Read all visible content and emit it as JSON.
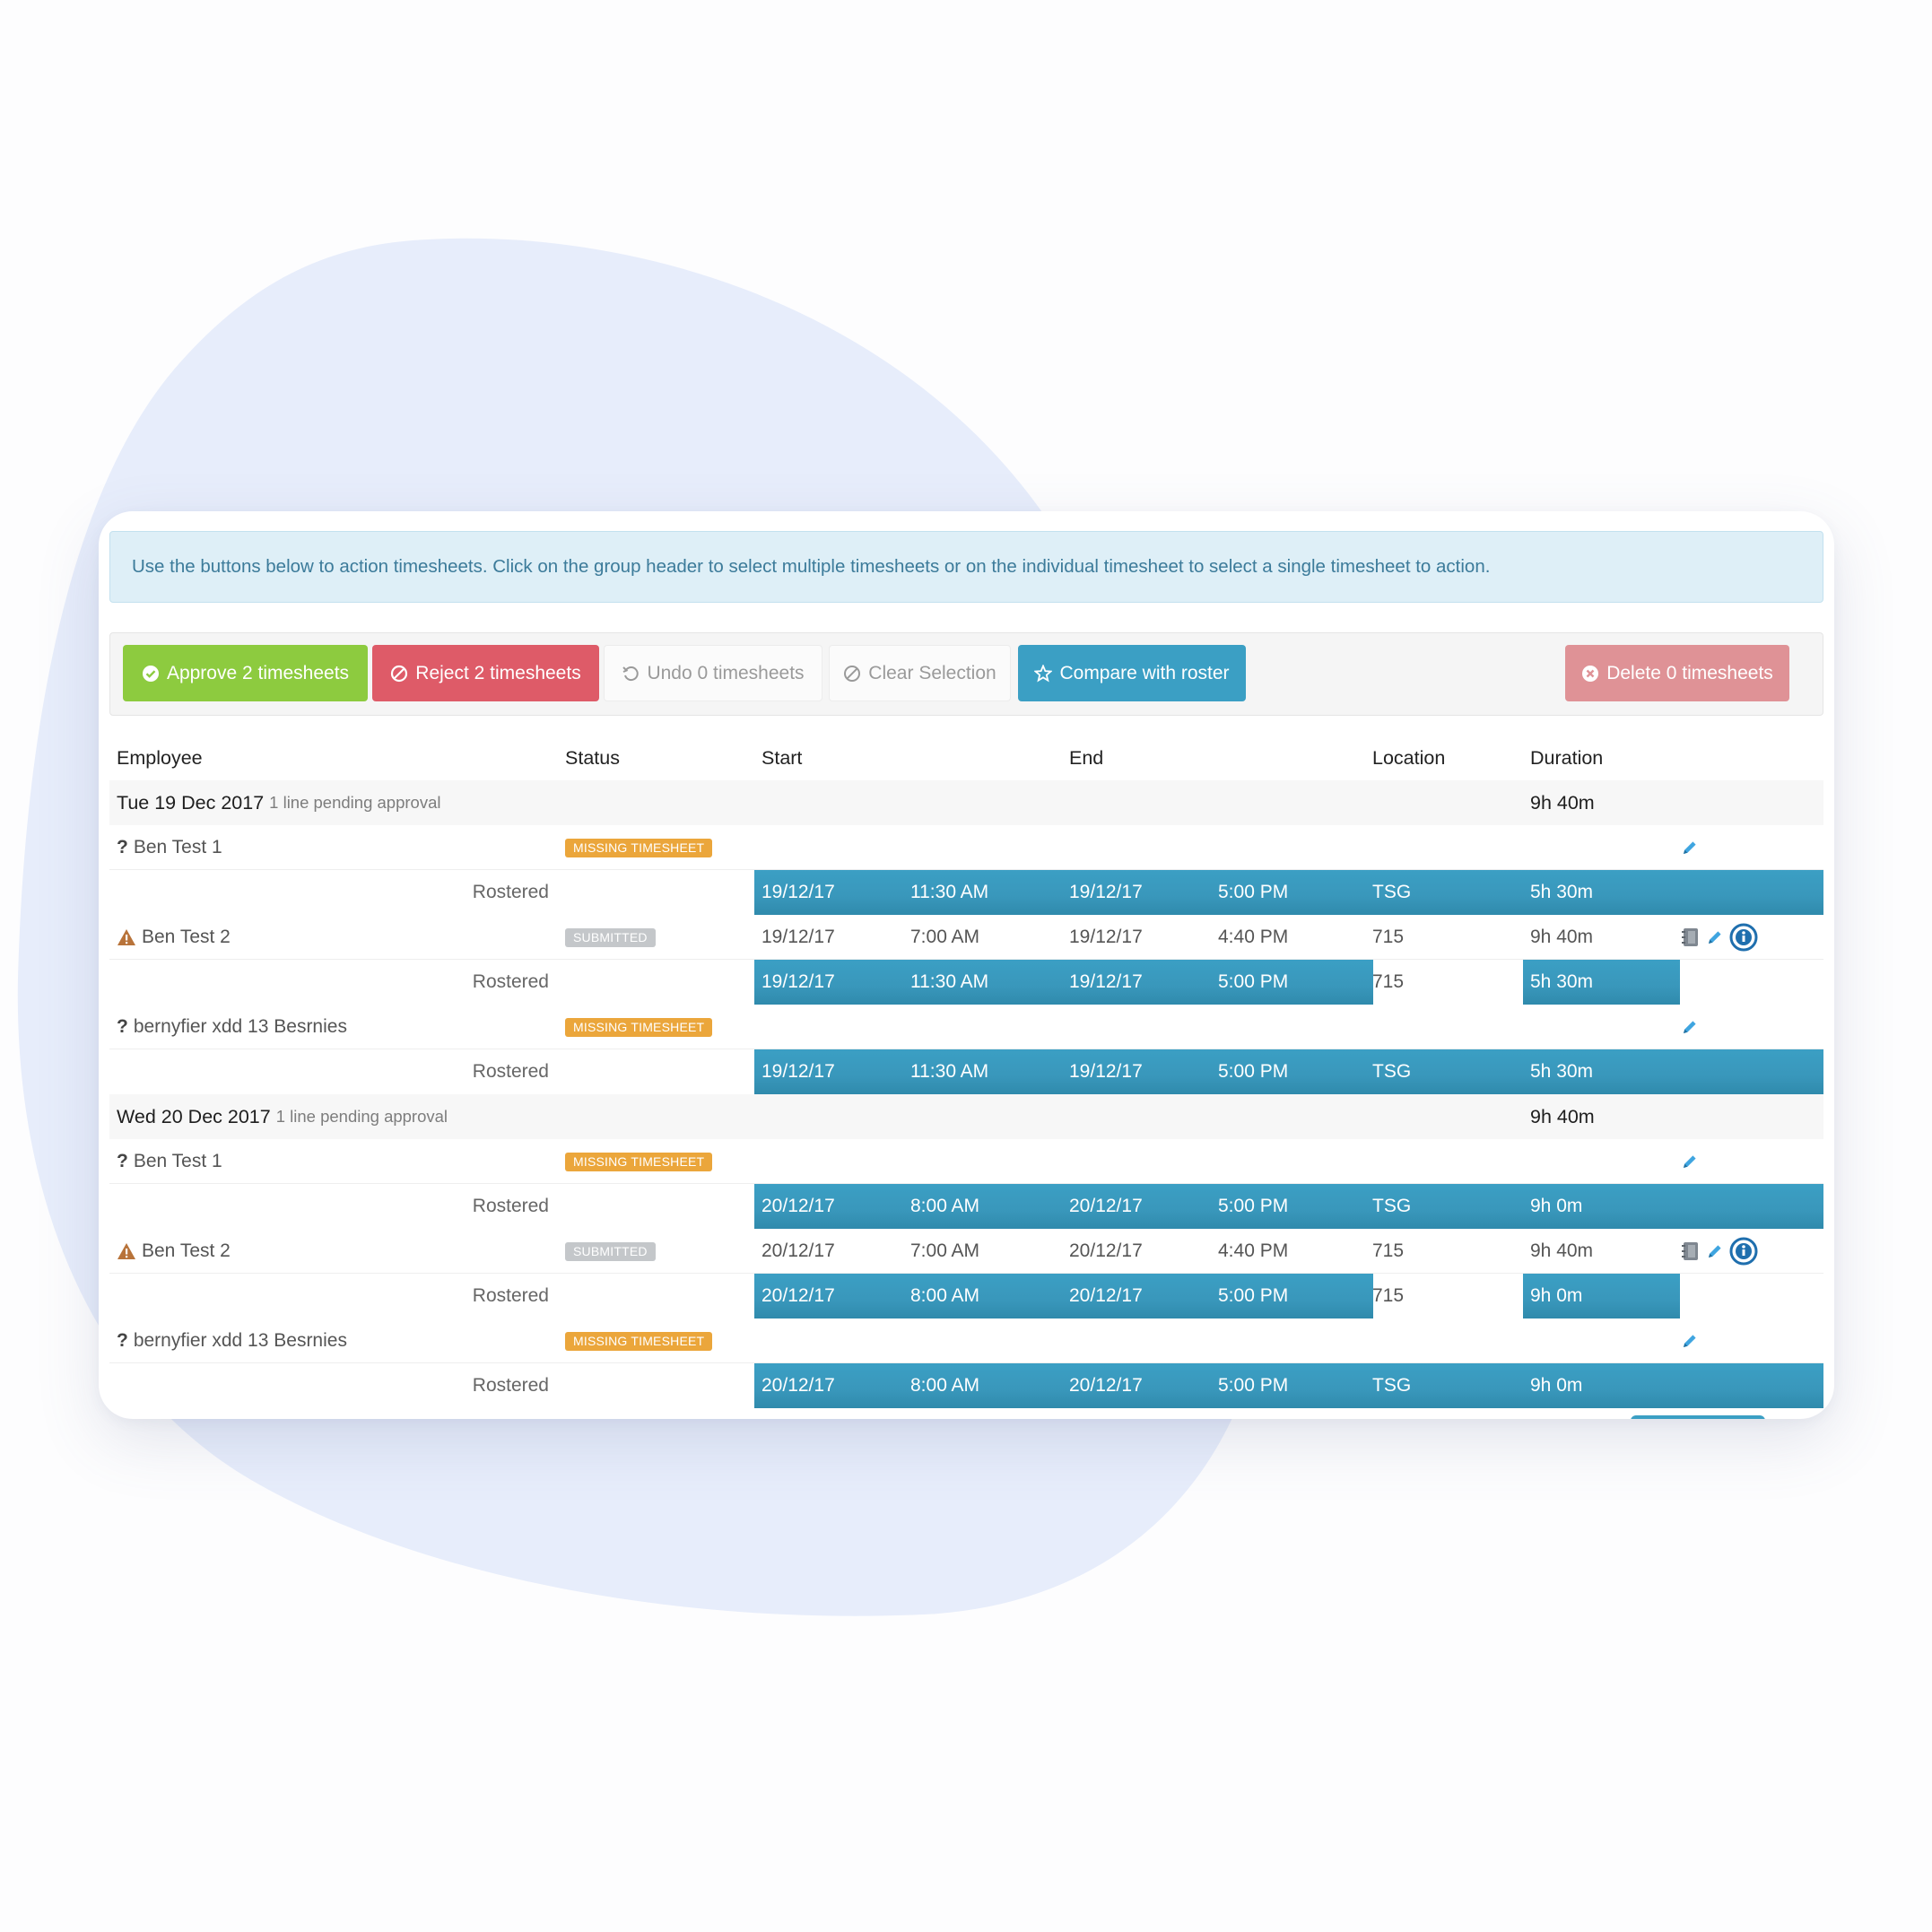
{
  "info": {
    "message": "Use the buttons below to action timesheets. Click on the group header to select multiple timesheets or on the individual timesheet to select a single timesheet to action."
  },
  "toolbar": {
    "approve": "Approve 2 timesheets",
    "reject": "Reject 2 timesheets",
    "undo": "Undo 0 timesheets",
    "clear": "Clear Selection",
    "compare": "Compare with roster",
    "delete": "Delete 0 timesheets"
  },
  "table": {
    "headers": {
      "employee": "Employee",
      "status": "Status",
      "start": "Start",
      "end": "End",
      "location": "Location",
      "duration": "Duration"
    },
    "rostered_label": "Rostered",
    "groups": [
      {
        "date": "Tue 19 Dec 2017",
        "pending": "1 line pending approval",
        "total": "9h 40m",
        "entries": [
          {
            "marker": "?",
            "name": "Ben Test 1",
            "status": "MISSING TIMESHEET",
            "start_date": "",
            "start_time": "",
            "end_date": "",
            "end_time": "",
            "location": "",
            "duration": "",
            "rostered": {
              "start_date": "19/12/17",
              "start_time": "11:30 AM",
              "end_date": "19/12/17",
              "end_time": "5:00 PM",
              "location": "TSG",
              "duration": "5h 30m"
            }
          },
          {
            "marker": "warning",
            "name": "Ben Test 2",
            "status": "SUBMITTED",
            "start_date": "19/12/17",
            "start_time": "7:00 AM",
            "end_date": "19/12/17",
            "end_time": "4:40 PM",
            "location": "715",
            "duration": "9h 40m",
            "rostered": {
              "start_date": "19/12/17",
              "start_time": "11:30 AM",
              "end_date": "19/12/17",
              "end_time": "5:00 PM",
              "location": "715",
              "duration": "5h 30m"
            }
          },
          {
            "marker": "?",
            "name": "bernyfier xdd 13 Besrnies",
            "status": "MISSING TIMESHEET",
            "start_date": "",
            "start_time": "",
            "end_date": "",
            "end_time": "",
            "location": "",
            "duration": "",
            "rostered": {
              "start_date": "19/12/17",
              "start_time": "11:30 AM",
              "end_date": "19/12/17",
              "end_time": "5:00 PM",
              "location": "TSG",
              "duration": "5h 30m"
            }
          }
        ]
      },
      {
        "date": "Wed 20 Dec 2017",
        "pending": "1 line pending approval",
        "total": "9h 40m",
        "entries": [
          {
            "marker": "?",
            "name": "Ben Test 1",
            "status": "MISSING TIMESHEET",
            "start_date": "",
            "start_time": "",
            "end_date": "",
            "end_time": "",
            "location": "",
            "duration": "",
            "rostered": {
              "start_date": "20/12/17",
              "start_time": "8:00 AM",
              "end_date": "20/12/17",
              "end_time": "5:00 PM",
              "location": "TSG",
              "duration": "9h 0m"
            }
          },
          {
            "marker": "warning",
            "name": "Ben Test 2",
            "status": "SUBMITTED",
            "start_date": "20/12/17",
            "start_time": "7:00 AM",
            "end_date": "20/12/17",
            "end_time": "4:40 PM",
            "location": "715",
            "duration": "9h 40m",
            "rostered": {
              "start_date": "20/12/17",
              "start_time": "8:00 AM",
              "end_date": "20/12/17",
              "end_time": "5:00 PM",
              "location": "715",
              "duration": "9h 0m"
            }
          },
          {
            "marker": "?",
            "name": "bernyfier xdd 13 Besrnies",
            "status": "MISSING TIMESHEET",
            "start_date": "",
            "start_time": "",
            "end_date": "",
            "end_time": "",
            "location": "",
            "duration": "",
            "rostered": {
              "start_date": "20/12/17",
              "start_time": "8:00 AM",
              "end_date": "20/12/17",
              "end_time": "5:00 PM",
              "location": "TSG",
              "duration": "9h 0m"
            }
          }
        ]
      }
    ]
  },
  "colors": {
    "approve": "#8dcb3f",
    "reject": "#de5b68",
    "compare": "#3b9fc4",
    "delete": "#df9296",
    "rostered_bar": "#3b9fc4",
    "missing_badge": "#eba63b",
    "submitted_badge": "#c4c7ca",
    "warning_icon": "#b8733a",
    "edit_icon": "#3fa5e0",
    "background_blob": "#e7edfb"
  },
  "icons": {
    "approve": "check-circle-icon",
    "reject": "ban-icon",
    "undo": "undo-icon",
    "clear": "ban-icon",
    "compare": "star-icon",
    "delete": "times-circle-icon",
    "edit": "pencil-icon",
    "warning": "warning-icon",
    "missing": "question-icon",
    "note": "notebook-icon",
    "info": "info-circle-icon"
  }
}
